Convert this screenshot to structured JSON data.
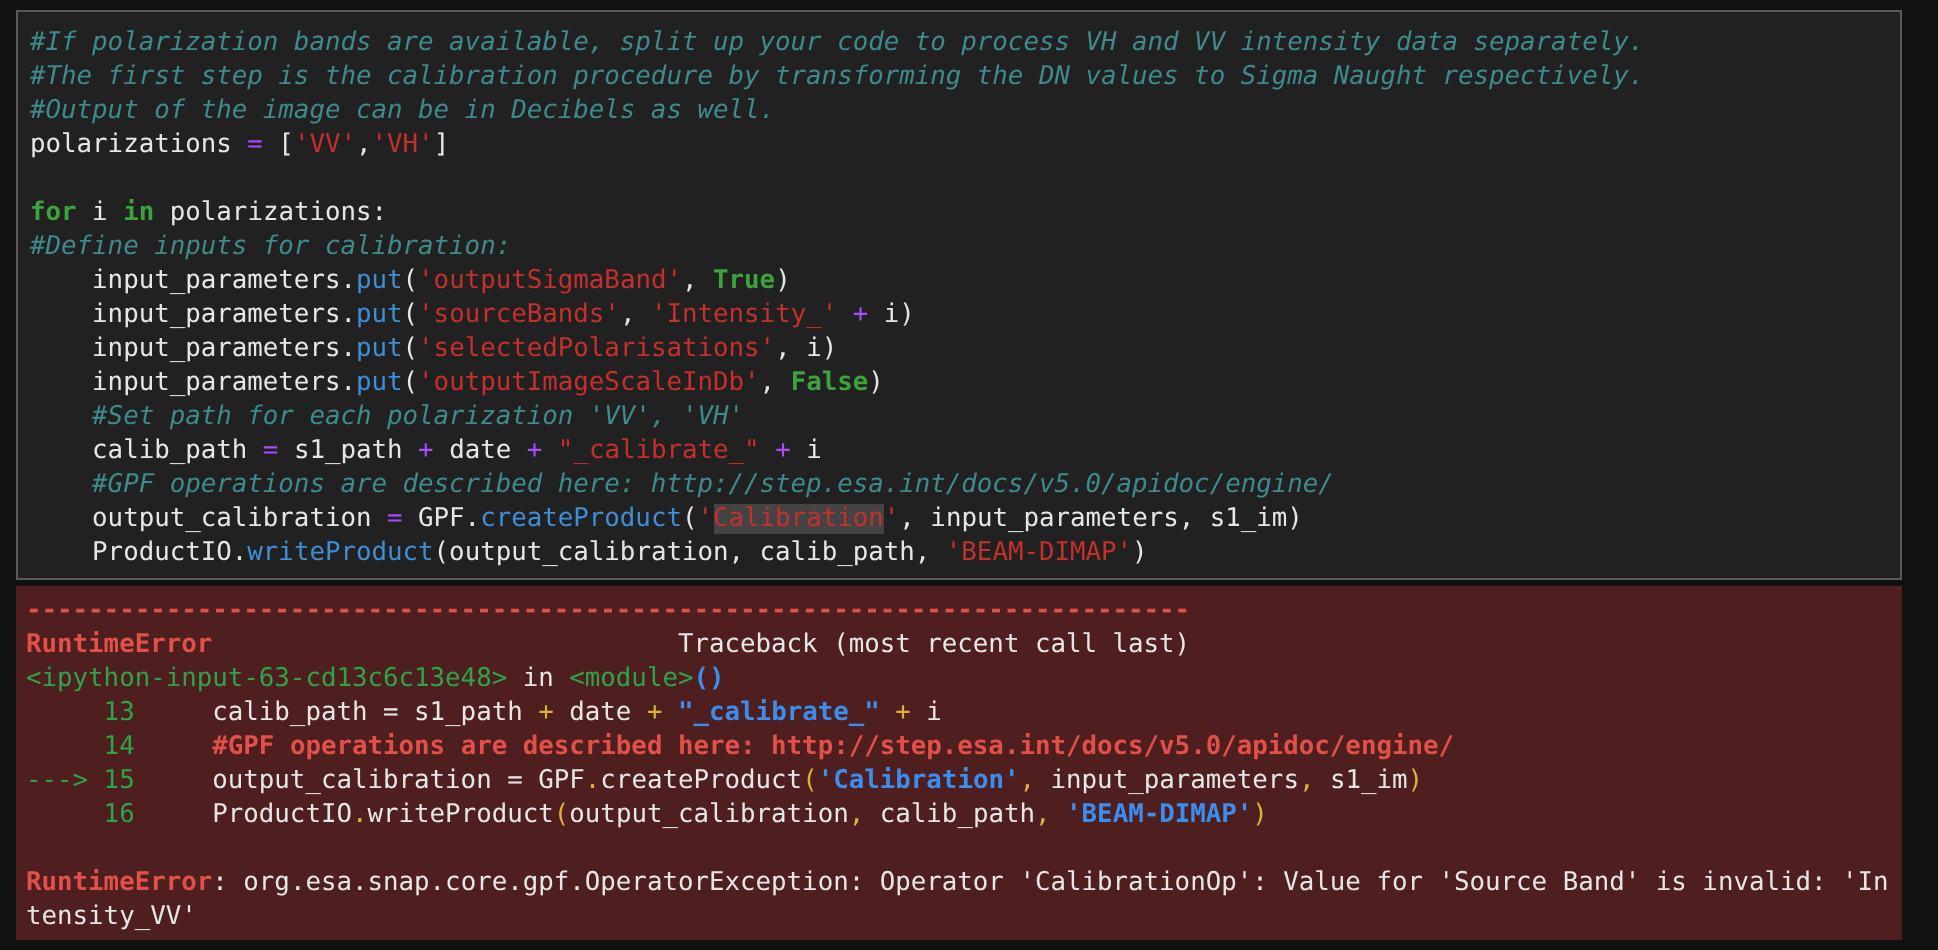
{
  "code_cell": {
    "lines": [
      {
        "tokens": [
          {
            "text": "#If polarization bands are available, split up your code to process VH and VV intensity data separately.",
            "kind": "comment"
          }
        ]
      },
      {
        "tokens": [
          {
            "text": "#The first step is the calibration procedure by transforming the DN values to Sigma Naught respectively.",
            "kind": "comment"
          }
        ]
      },
      {
        "tokens": [
          {
            "text": "#Output of the image can be in Decibels as well.",
            "kind": "comment"
          }
        ]
      },
      {
        "tokens": [
          {
            "text": "polarizations ",
            "kind": "plain"
          },
          {
            "text": "=",
            "kind": "operator"
          },
          {
            "text": " [",
            "kind": "plain"
          },
          {
            "text": "'VV'",
            "kind": "string"
          },
          {
            "text": ",",
            "kind": "plain"
          },
          {
            "text": "'VH'",
            "kind": "string"
          },
          {
            "text": "]",
            "kind": "plain"
          }
        ]
      },
      {
        "kind": "blank"
      },
      {
        "tokens": [
          {
            "text": "for",
            "kind": "keyword"
          },
          {
            "text": " i ",
            "kind": "plain"
          },
          {
            "text": "in",
            "kind": "keyword"
          },
          {
            "text": " polarizations:",
            "kind": "plain"
          }
        ]
      },
      {
        "tokens": [
          {
            "text": "#Define inputs for calibration:",
            "kind": "comment"
          }
        ]
      },
      {
        "tokens": [
          {
            "text": "    input_parameters.",
            "kind": "plain"
          },
          {
            "text": "put",
            "kind": "method"
          },
          {
            "text": "(",
            "kind": "plain"
          },
          {
            "text": "'outputSigmaBand'",
            "kind": "string"
          },
          {
            "text": ", ",
            "kind": "plain"
          },
          {
            "text": "True",
            "kind": "keyword"
          },
          {
            "text": ")",
            "kind": "plain"
          }
        ]
      },
      {
        "tokens": [
          {
            "text": "    input_parameters.",
            "kind": "plain"
          },
          {
            "text": "put",
            "kind": "method"
          },
          {
            "text": "(",
            "kind": "plain"
          },
          {
            "text": "'sourceBands'",
            "kind": "string"
          },
          {
            "text": ", ",
            "kind": "plain"
          },
          {
            "text": "'Intensity_' ",
            "kind": "string"
          },
          {
            "text": "+",
            "kind": "operator"
          },
          {
            "text": " i)",
            "kind": "plain"
          }
        ]
      },
      {
        "tokens": [
          {
            "text": "    input_parameters.",
            "kind": "plain"
          },
          {
            "text": "put",
            "kind": "method"
          },
          {
            "text": "(",
            "kind": "plain"
          },
          {
            "text": "'selectedPolarisations'",
            "kind": "string"
          },
          {
            "text": ", i)",
            "kind": "plain"
          }
        ]
      },
      {
        "tokens": [
          {
            "text": "    input_parameters.",
            "kind": "plain"
          },
          {
            "text": "put",
            "kind": "method"
          },
          {
            "text": "(",
            "kind": "plain"
          },
          {
            "text": "'outputImageScaleInDb'",
            "kind": "string"
          },
          {
            "text": ", ",
            "kind": "plain"
          },
          {
            "text": "False",
            "kind": "keyword"
          },
          {
            "text": ")",
            "kind": "plain"
          }
        ]
      },
      {
        "tokens": [
          {
            "text": "    #Set path for each polarization 'VV', 'VH'",
            "kind": "comment"
          }
        ]
      },
      {
        "tokens": [
          {
            "text": "    calib_path ",
            "kind": "plain"
          },
          {
            "text": "=",
            "kind": "operator"
          },
          {
            "text": " s1_path ",
            "kind": "plain"
          },
          {
            "text": "+",
            "kind": "operator"
          },
          {
            "text": " date ",
            "kind": "plain"
          },
          {
            "text": "+ ",
            "kind": "operator"
          },
          {
            "text": "\"_calibrate_\" ",
            "kind": "string"
          },
          {
            "text": "+",
            "kind": "operator"
          },
          {
            "text": " i",
            "kind": "plain"
          }
        ]
      },
      {
        "tokens": [
          {
            "text": "    #GPF operations are described here: http://step.esa.int/docs/v5.0/apidoc/engine/",
            "kind": "comment"
          }
        ]
      },
      {
        "tokens": [
          {
            "text": "    output_calibration ",
            "kind": "plain"
          },
          {
            "text": "=",
            "kind": "operator"
          },
          {
            "text": " GPF.",
            "kind": "plain"
          },
          {
            "text": "createProduct",
            "kind": "method"
          },
          {
            "text": "(",
            "kind": "plain"
          },
          {
            "text": "'",
            "kind": "string"
          },
          {
            "text": "Calibration",
            "kind": "selected_string"
          },
          {
            "text": "'",
            "kind": "string"
          },
          {
            "text": ", input_parameters, s1_im)",
            "kind": "plain"
          }
        ]
      },
      {
        "tokens": [
          {
            "text": "    ProductIO.",
            "kind": "plain"
          },
          {
            "text": "writeProduct",
            "kind": "method"
          },
          {
            "text": "(output_calibration, calib_path, ",
            "kind": "plain"
          },
          {
            "text": "'BEAM-DIMAP'",
            "kind": "string"
          },
          {
            "text": ")",
            "kind": "plain"
          }
        ]
      }
    ]
  },
  "error_output": {
    "lines": [
      {
        "tokens": [
          {
            "text": "---------------------------------------------------------------------------",
            "kind": "error"
          }
        ]
      },
      {
        "tokens": [
          {
            "text": "RuntimeError",
            "kind": "error"
          },
          {
            "text": "                              Traceback (most recent call last)",
            "kind": "plain"
          }
        ]
      },
      {
        "tokens": [
          {
            "text": "<ipython-input-63-cd13c6c13e48>",
            "kind": "location"
          },
          {
            "text": " in ",
            "kind": "plain"
          },
          {
            "text": "<module>",
            "kind": "location"
          },
          {
            "text": "()",
            "kind": "string"
          }
        ]
      },
      {
        "tokens": [
          {
            "text": "     13",
            "kind": "location"
          },
          {
            "text": "     calib_path = s1_path ",
            "kind": "plain"
          },
          {
            "text": "+",
            "kind": "punct"
          },
          {
            "text": " date ",
            "kind": "plain"
          },
          {
            "text": "+ ",
            "kind": "punct"
          },
          {
            "text": "\"_calibrate_\" ",
            "kind": "string"
          },
          {
            "text": "+",
            "kind": "punct"
          },
          {
            "text": " i",
            "kind": "plain"
          }
        ]
      },
      {
        "tokens": [
          {
            "text": "     14     ",
            "kind": "location"
          },
          {
            "text": "#GPF operations are described here: http://step.esa.int/docs/v5.0/apidoc/engine/",
            "kind": "error"
          }
        ]
      },
      {
        "tokens": [
          {
            "text": "---> 15",
            "kind": "location"
          },
          {
            "text": "     output_calibration = GPF",
            "kind": "plain"
          },
          {
            "text": ".",
            "kind": "punct"
          },
          {
            "text": "createProduct",
            "kind": "plain"
          },
          {
            "text": "(",
            "kind": "punct"
          },
          {
            "text": "'Calibration'",
            "kind": "string"
          },
          {
            "text": ",",
            "kind": "punct"
          },
          {
            "text": " input_parameters",
            "kind": "plain"
          },
          {
            "text": ",",
            "kind": "punct"
          },
          {
            "text": " s1_im",
            "kind": "plain"
          },
          {
            "text": ")",
            "kind": "punct"
          }
        ]
      },
      {
        "tokens": [
          {
            "text": "     16",
            "kind": "location"
          },
          {
            "text": "     ProductIO",
            "kind": "plain"
          },
          {
            "text": ".",
            "kind": "punct"
          },
          {
            "text": "writeProduct",
            "kind": "plain"
          },
          {
            "text": "(",
            "kind": "punct"
          },
          {
            "text": "output_calibration",
            "kind": "plain"
          },
          {
            "text": ",",
            "kind": "punct"
          },
          {
            "text": " calib_path",
            "kind": "plain"
          },
          {
            "text": ", ",
            "kind": "punct"
          },
          {
            "text": "'BEAM-DIMAP'",
            "kind": "string"
          },
          {
            "text": ")",
            "kind": "punct"
          }
        ]
      },
      {
        "kind": "blank"
      },
      {
        "tokens": [
          {
            "text": "RuntimeError",
            "kind": "error"
          },
          {
            "text": ": org.esa.snap.core.gpf.OperatorException: Operator 'CalibrationOp': Value for 'Source Band' is invalid: 'Intensity_VV'",
            "kind": "plain"
          }
        ]
      }
    ]
  }
}
